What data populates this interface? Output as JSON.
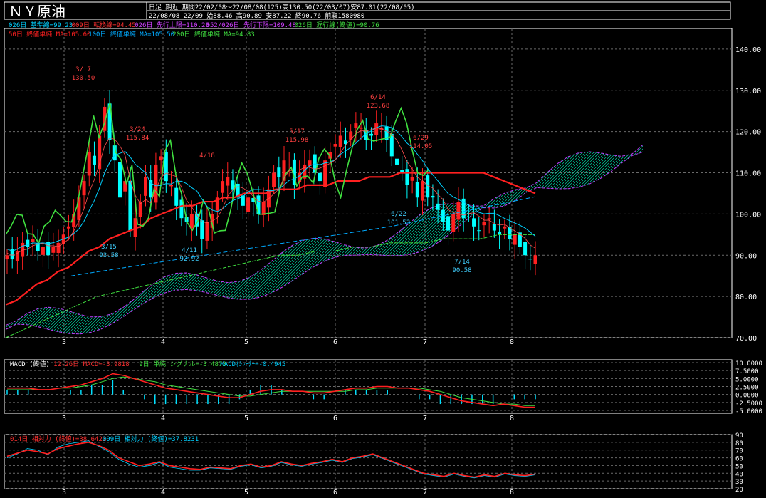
{
  "header": {
    "title": "ＮＹ原油",
    "kind": "日足 期近",
    "info1": "期間22/02/08～22/08/08(125)高130.50(22/03/07)安87.01(22/08/05)",
    "info2": "22/08/08 22/09 始88.46 高90.89 安87.22 終90.76 前取1580980"
  },
  "legend1": [
    {
      "text": "026日 基準線=99.23",
      "color": "#00d0ff"
    },
    {
      "text": "009日 転換線=94.45",
      "color": "#ff3030"
    },
    {
      "text": "026日 先行上限=110.20",
      "color": "#d040ff"
    },
    {
      "text": "052/026日 先行下限=109.48",
      "color": "#d040ff"
    },
    {
      "text": "026日 遅行線(終値)=90.76",
      "color": "#40e040"
    }
  ],
  "legend2": [
    {
      "text": "50日 終値単純 MA=105.60",
      "color": "#ff2020"
    },
    {
      "text": "100日 終値単純 MA=105.50",
      "color": "#00aaff"
    },
    {
      "text": "200日 終値単純 MA=94.83",
      "color": "#40e040"
    }
  ],
  "macd_legend": [
    {
      "text": "MACD (終値)",
      "color": "#ffffff"
    },
    {
      "text": "12-26日 MACD=-3.9818",
      "color": "#ff3030"
    },
    {
      "text": "9日 単純 シグナル=-3.4873",
      "color": "#40e040"
    },
    {
      "text": "MACDｵｼﾚｰﾀｰ=-0.4945",
      "color": "#00d0ff"
    }
  ],
  "rsi_legend": [
    {
      "text": "014日 相対力 (終値)=38.6421",
      "color": "#ff3030"
    },
    {
      "text": "009日 相対力 (終値)=37.8231",
      "color": "#00d0ff"
    }
  ],
  "main_yticks": [
    "140.00",
    "130.00",
    "120.00",
    "110.00",
    "100.00",
    "90.00",
    "80.00",
    "70.00"
  ],
  "macd_yticks": [
    "10.0000",
    "7.5000",
    "5.0000",
    "2.5000",
    "0.0000",
    "-2.5000",
    "-5.0000"
  ],
  "rsi_yticks": [
    "90",
    "80",
    "70",
    "60",
    "50",
    "40",
    "30",
    "20"
  ],
  "xticks": [
    "3",
    "4",
    "5",
    "6",
    "7",
    "8"
  ],
  "annotations": [
    {
      "date": "3/ 7",
      "value": "130.50"
    },
    {
      "date": "3/24",
      "value": "115.84"
    },
    {
      "date": "3/15",
      "value": "93.58"
    },
    {
      "date": "4/18",
      "value": ""
    },
    {
      "date": "4/11",
      "value": "92.92"
    },
    {
      "date": "5/17",
      "value": "115.98"
    },
    {
      "date": "6/14",
      "value": "123.68"
    },
    {
      "date": "6/29",
      "value": "114.05"
    },
    {
      "date": "6/22",
      "value": "101.53"
    },
    {
      "date": "7/14",
      "value": "90.58"
    }
  ],
  "colors": {
    "up": "#ff2020",
    "down": "#00ffff",
    "grid": "#6a6a6a"
  },
  "chart_data": [
    {
      "type": "candlestick",
      "title": "ＮＹ原油",
      "ylim": [
        70,
        145
      ],
      "x_labels": [
        "3",
        "4",
        "5",
        "6",
        "7",
        "8"
      ],
      "series": [
        {
          "name": "price",
          "values": [
            90,
            89,
            91,
            93,
            92,
            94,
            91,
            92,
            90,
            92,
            93,
            95,
            97,
            100,
            104,
            108,
            115,
            112,
            119,
            126,
            118,
            113,
            104,
            108,
            96,
            99,
            103,
            109,
            104,
            112,
            114,
            108,
            107,
            102,
            99,
            98,
            100,
            97,
            94,
            98,
            100,
            104,
            108,
            109,
            106,
            104,
            102,
            104,
            103,
            100,
            103,
            106,
            110,
            109,
            113,
            112,
            107,
            110,
            112,
            113,
            110,
            108,
            113,
            115,
            117,
            119,
            117,
            120,
            122,
            121,
            118,
            119,
            122,
            121,
            118,
            114,
            112,
            110,
            107,
            109,
            104,
            108,
            104,
            104,
            101,
            98,
            96,
            100,
            103,
            99,
            100,
            97,
            96,
            98,
            99,
            96,
            95,
            97,
            94,
            95,
            92,
            90,
            89,
            90
          ]
        },
        {
          "name": "50日 終値単純 MA",
          "values": [
            78,
            79,
            81,
            83,
            84,
            86,
            87,
            89,
            91,
            92,
            94,
            95,
            96,
            97,
            99,
            100,
            101,
            102,
            102,
            103,
            103,
            104,
            104,
            105,
            105,
            105,
            106,
            106,
            106,
            107,
            107,
            107,
            108,
            108,
            108,
            109,
            109,
            109,
            110,
            110,
            110,
            110,
            110,
            110,
            110,
            110,
            110,
            109,
            108,
            107,
            106,
            105
          ]
        },
        {
          "name": "200日 終値単純 MA",
          "values": [
            70,
            72,
            74,
            76,
            78,
            80,
            81,
            82,
            83,
            84,
            85,
            86,
            87,
            88,
            89,
            90,
            90,
            91,
            91,
            92,
            92,
            93,
            93,
            93,
            94,
            94,
            94,
            95,
            95,
            95
          ]
        }
      ]
    },
    {
      "type": "line",
      "title": "MACD (終値)",
      "ylim": [
        -5,
        10
      ],
      "series": [
        {
          "name": "12-26日 MACD",
          "values": [
            2,
            2,
            2,
            1.5,
            1.5,
            2,
            2.5,
            3,
            4,
            5,
            6.5,
            6,
            5,
            4,
            3,
            2,
            1.5,
            1,
            0.5,
            0,
            -0.5,
            -1,
            -1,
            0,
            1,
            1.5,
            1.5,
            1,
            1,
            0.5,
            0.5,
            1,
            1.5,
            2,
            2,
            2.5,
            2.5,
            2,
            2,
            1.5,
            1,
            0,
            -1,
            -2,
            -2.5,
            -3,
            -3.5,
            -3,
            -3.5,
            -4,
            -4
          ]
        },
        {
          "name": "9日 単純 シグナル",
          "values": [
            1.5,
            1.5,
            1.5,
            1.5,
            1.5,
            2,
            2,
            2.5,
            3,
            4,
            5,
            5.5,
            5,
            4.5,
            4,
            3,
            2.5,
            2,
            1.5,
            1,
            0.5,
            0,
            -0.5,
            -0.5,
            0,
            0.5,
            1,
            1,
            1,
            1,
            1,
            1,
            1,
            1.5,
            1.5,
            2,
            2,
            2,
            2,
            2,
            1.5,
            1,
            0,
            -1,
            -1.5,
            -2,
            -2.5,
            -3,
            -3,
            -3.5,
            -3.5
          ]
        }
      ]
    },
    {
      "type": "line",
      "title": "相対力",
      "ylim": [
        20,
        90
      ],
      "series": [
        {
          "name": "014日 相対力 (終値)",
          "values": [
            62,
            66,
            70,
            68,
            65,
            72,
            75,
            78,
            80,
            76,
            70,
            60,
            55,
            50,
            52,
            55,
            50,
            48,
            46,
            45,
            48,
            47,
            46,
            50,
            52,
            48,
            50,
            55,
            52,
            50,
            53,
            55,
            58,
            55,
            60,
            62,
            65,
            60,
            55,
            50,
            45,
            40,
            38,
            36,
            40,
            37,
            35,
            38,
            36,
            40,
            38,
            37,
            39
          ]
        },
        {
          "name": "009日 相対力 (終値)",
          "values": [
            60,
            65,
            72,
            70,
            64,
            74,
            78,
            80,
            82,
            75,
            68,
            58,
            52,
            48,
            50,
            54,
            48,
            46,
            44,
            44,
            47,
            46,
            45,
            49,
            51,
            47,
            49,
            54,
            51,
            49,
            52,
            54,
            57,
            54,
            59,
            61,
            64,
            59,
            54,
            49,
            44,
            39,
            37,
            35,
            39,
            36,
            34,
            37,
            35,
            39,
            37,
            36,
            38
          ]
        }
      ]
    }
  ]
}
